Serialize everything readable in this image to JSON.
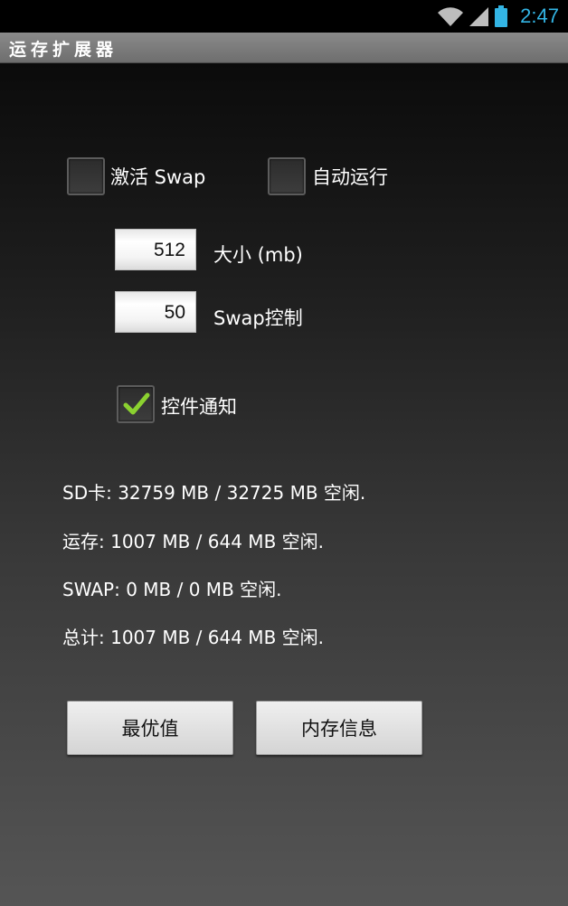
{
  "status_bar": {
    "time": "2:47",
    "icons": [
      "wifi-icon",
      "signal-icon",
      "battery-icon"
    ],
    "accent_color": "#33b5e5"
  },
  "app": {
    "title": "运存扩展器"
  },
  "options": {
    "activate_swap": {
      "label": "激活 Swap",
      "checked": false
    },
    "autorun": {
      "label": "自动运行",
      "checked": false
    },
    "widget_notify": {
      "label": "控件通知",
      "checked": true
    }
  },
  "fields": {
    "size": {
      "value": "512",
      "label": "大小 (mb)"
    },
    "swap_control": {
      "value": "50",
      "label": "Swap控制"
    }
  },
  "info": {
    "sd": "SD卡: 32759 MB / 32725 MB 空闲.",
    "ram": "运存: 1007 MB / 644 MB 空闲.",
    "swap": "SWAP: 0 MB / 0 MB 空闲.",
    "total": "总计: 1007 MB / 644 MB 空闲."
  },
  "buttons": {
    "optimal": "最优值",
    "memory_info": "内存信息"
  }
}
